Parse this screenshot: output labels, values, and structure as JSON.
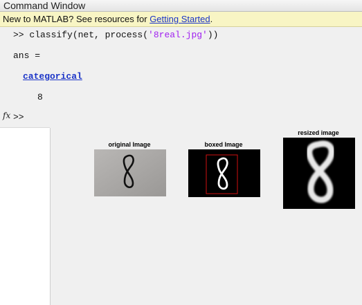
{
  "window": {
    "title": "Command Window"
  },
  "banner": {
    "text": "New to MATLAB? See resources for ",
    "link_label": "Getting Started",
    "trailing": "."
  },
  "console": {
    "prompt": ">> ",
    "command_prefix": "classify(net, process(",
    "command_string": "'8real.jpg'",
    "command_suffix": "))",
    "ans_line": "ans =",
    "result_type": "categorical",
    "result_value": "8",
    "fx_symbol": "fx",
    "active_prompt": ">>"
  },
  "figure": {
    "subplots": [
      {
        "title": "original Image"
      },
      {
        "title": "boxed Image"
      },
      {
        "title": "resized image"
      }
    ],
    "colors": {
      "original_bg": "#a8a6a4",
      "box_outline": "#d01010",
      "digit_white": "#ffffff",
      "image_black": "#000000"
    }
  }
}
